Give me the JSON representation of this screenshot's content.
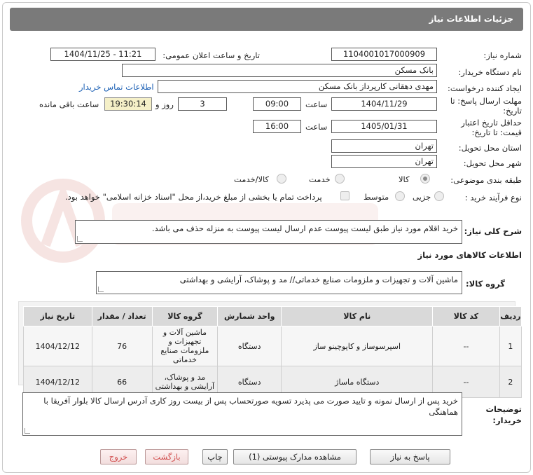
{
  "header": {
    "title": "جزئیات اطلاعات نیاز"
  },
  "fields": {
    "need_number_label": "شماره نیاز:",
    "need_number": "1104001017000909",
    "announce_label": "تاریخ و ساعت اعلان عمومی:",
    "announce_value": "1404/11/25 - 11:21",
    "buyer_org_label": "نام دستگاه خریدار:",
    "buyer_org": "بانک مسکن",
    "requester_label": "ایجاد کننده درخواست:",
    "requester": "مهدی دهقانی کارپرداز بانک مسکن",
    "contact_link": "اطلاعات تماس خریدار",
    "deadline_label_1": "مهلت ارسال پاسخ: تا",
    "deadline_label_2": "تاریخ:",
    "deadline_date": "1404/11/29",
    "time_label": "ساعت",
    "deadline_time": "09:00",
    "days_value": "3",
    "days_label": "روز و",
    "remaining_time": "19:30:14",
    "remaining_label": "ساعت باقی مانده",
    "validity_label_1": "حداقل تاریخ اعتبار",
    "validity_label_2": "قیمت: تا تاریخ:",
    "validity_date": "1405/01/31",
    "validity_time_label": "ساعت",
    "validity_time": "16:00",
    "province_label": "استان محل تحویل:",
    "province": "تهران",
    "city_label": "شهر محل تحویل:",
    "city": "تهران",
    "category_label": "طبقه بندی موضوعی:",
    "category_options": [
      "کالا",
      "خدمت",
      "کالا/خدمت"
    ],
    "category_selected": "کالا",
    "process_label": "نوع فرآیند خرید :",
    "process_options": [
      "جزیی",
      "متوسط"
    ],
    "treasury_note": "پرداخت تمام یا بخشی از مبلغ خرید،از محل \"اسناد خزانه اسلامی\" خواهد بود."
  },
  "description": {
    "label": "شرح کلی نیاز:",
    "text": "خرید اقلام مورد نیاز طبق لیست پیوست عدم ارسال لیست پیوست به منزله حذف می باشد."
  },
  "goods_section": {
    "title": "اطلاعات کالاهای مورد نیاز",
    "group_label": "گروه کالا:",
    "group_text": "ماشین آلات و تجهیزات و ملزومات صنایع خدماتی// مد و پوشاک، آرایشی و بهداشتی"
  },
  "table": {
    "headers": [
      "ردیف",
      "کد کالا",
      "نام کالا",
      "واحد شمارش",
      "گروه کالا",
      "تعداد / مقدار",
      "تاریخ نیاز"
    ],
    "rows": [
      [
        "1",
        "--",
        "اسپرسوساز و کاپوچینو ساز",
        "دستگاه",
        "ماشین آلات و تجهیزات و ملزومات صنایع خدماتی",
        "76",
        "1404/12/12"
      ],
      [
        "2",
        "--",
        "دستگاه ماساژ",
        "دستگاه",
        "مد و پوشاک، آرایشی و بهداشتی",
        "66",
        "1404/12/12"
      ]
    ]
  },
  "buyer_notes": {
    "label_1": "توضیحات",
    "label_2": "خریدار:",
    "text": "خرید پس از ارسال نمونه و تایید صورت می پذیرد تسویه صورتحساب پس از بیست روز کاری آدرس ارسال کالا بلوار آفریقا با هماهنگی"
  },
  "buttons": {
    "reply": "پاسخ به نیاز",
    "attachments": "مشاهده مدارک پیوستی (1)",
    "print": "چاپ",
    "back": "بازگشت",
    "exit": "خروج"
  },
  "colors": {
    "header": "#7a7a7a",
    "link": "#1a5fb4",
    "remaining_bg": "#f5f0c8",
    "danger": "#d14b4b"
  }
}
